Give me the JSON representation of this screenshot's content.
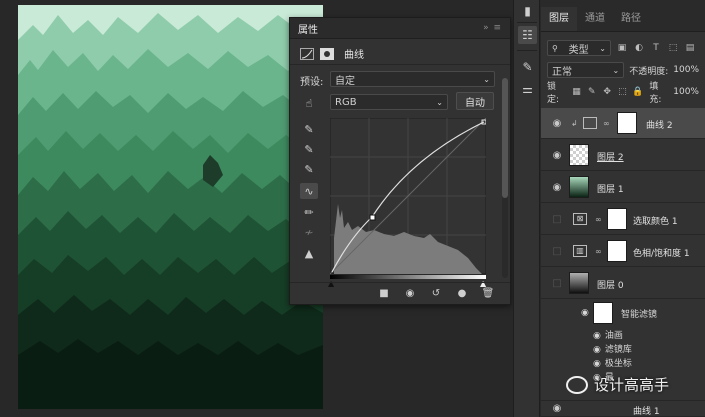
{
  "properties_panel": {
    "title": "属性",
    "panel_controls": "»  ≡",
    "adjustment_name": "曲线",
    "preset_label": "预设:",
    "preset_value": "自定",
    "channel_value": "RGB",
    "auto_button": "自动"
  },
  "layers_panel": {
    "tabs": [
      "图层",
      "通道",
      "路径"
    ],
    "filter_value": "类型",
    "blend_mode": "正常",
    "opacity_label": "不透明度:",
    "opacity_value": "100%",
    "lock_label": "锁定:",
    "fill_label": "填充:",
    "fill_value": "100%",
    "layers": [
      {
        "name": "曲线 2",
        "kind": "curves-adjustment",
        "visible": true,
        "selected": true
      },
      {
        "name": "图层 2",
        "kind": "pixel-transparent",
        "visible": true,
        "selected": false
      },
      {
        "name": "图层 1",
        "kind": "pixel-gradient",
        "visible": true,
        "selected": false
      },
      {
        "name": "选取颜色 1",
        "kind": "selective-color-adjustment",
        "visible": false,
        "selected": false
      },
      {
        "name": "色相/饱和度 1",
        "kind": "hue-saturation-adjustment",
        "visible": false,
        "selected": false
      },
      {
        "name": "图层 0",
        "kind": "smart-object",
        "visible": false,
        "selected": false
      }
    ],
    "smart_filters_label": "智能滤镜",
    "smart_filters": [
      "油画",
      "滤镜库",
      "极坐标",
      "最"
    ],
    "bottom_layer_partial": "曲线 1"
  },
  "watermark": "设计高高手",
  "colors": {
    "accent_green_light": "#a8d8bb",
    "accent_green_mid": "#3e8a5f",
    "panel_bg": "#323232",
    "selected_row": "#4a4a4a"
  },
  "icons": [
    "curves-icon",
    "eyedropper-icon",
    "pencil-icon",
    "smooth-icon",
    "eye-icon",
    "trash-icon",
    "reset-icon",
    "link-icon"
  ]
}
